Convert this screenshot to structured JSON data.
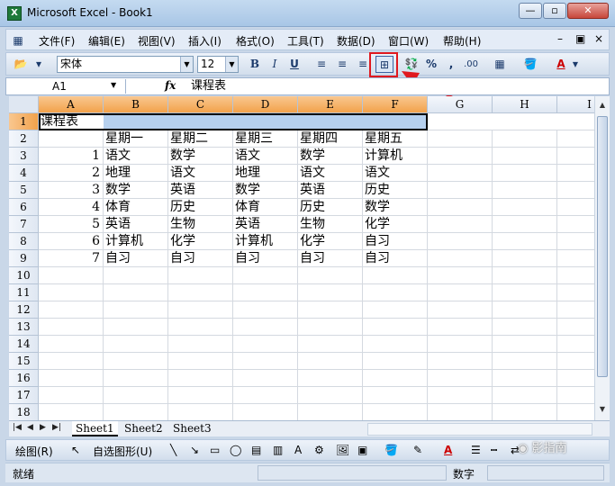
{
  "window": {
    "title": "Microsoft Excel - Book1",
    "app_icon_letter": "X"
  },
  "menu": [
    "文件(F)",
    "编辑(E)",
    "视图(V)",
    "插入(I)",
    "格式(O)",
    "工具(T)",
    "数据(D)",
    "窗口(W)",
    "帮助(H)"
  ],
  "toolbar": {
    "font_name": "宋体",
    "font_size": "12",
    "bold": "B",
    "italic": "I",
    "underline": "U",
    "percent": "%",
    "comma": ",",
    "font_color_label": "A"
  },
  "formula_bar": {
    "name_box": "A1",
    "fx_label": "fx",
    "value": "课程表"
  },
  "columns": [
    "A",
    "B",
    "C",
    "D",
    "E",
    "F",
    "G",
    "H",
    "I"
  ],
  "rows": [
    "1",
    "2",
    "3",
    "4",
    "5",
    "6",
    "7",
    "8",
    "9",
    "10",
    "11",
    "12",
    "13",
    "14",
    "15",
    "16",
    "17",
    "18"
  ],
  "cells": {
    "A1": "课程表",
    "B2": "星期一",
    "C2": "星期二",
    "D2": "星期三",
    "E2": "星期四",
    "F2": "星期五",
    "A3": "1",
    "B3": "语文",
    "C3": "数学",
    "D3": "语文",
    "E3": "数学",
    "F3": "计算机",
    "A4": "2",
    "B4": "地理",
    "C4": "语文",
    "D4": "地理",
    "E4": "语文",
    "F4": "语文",
    "A5": "3",
    "B5": "数学",
    "C5": "英语",
    "D5": "数学",
    "E5": "英语",
    "F5": "历史",
    "A6": "4",
    "B6": "体育",
    "C6": "历史",
    "D6": "体育",
    "E6": "历史",
    "F6": "数学",
    "A7": "5",
    "B7": "英语",
    "C7": "生物",
    "D7": "英语",
    "E7": "生物",
    "F7": "化学",
    "A8": "6",
    "B8": "计算机",
    "C8": "化学",
    "D8": "计算机",
    "E8": "化学",
    "F8": "自习",
    "A9": "7",
    "B9": "自习",
    "C9": "自习",
    "D9": "自习",
    "E9": "自习",
    "F9": "自习"
  },
  "sheets": [
    "Sheet1",
    "Sheet2",
    "Sheet3"
  ],
  "drawing": {
    "draw_label": "绘图(R)",
    "autoshape_label": "自选图形(U)"
  },
  "status": {
    "left": "就绪",
    "right": "数字"
  },
  "colors": {
    "highlight": "#e0191f",
    "selected_header": "#f2a24b",
    "selection_fill": "#b6d0ee"
  }
}
